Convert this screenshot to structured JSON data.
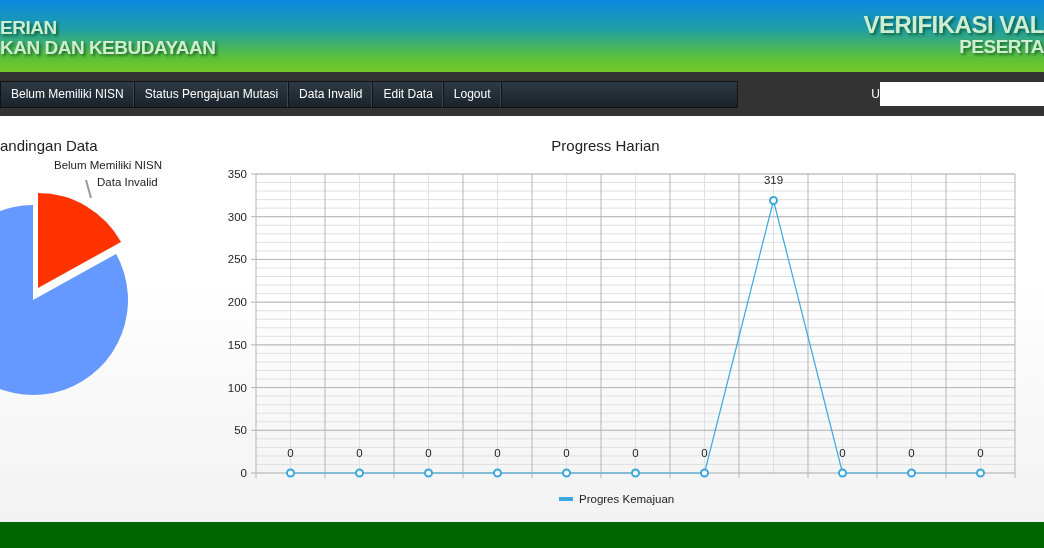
{
  "header": {
    "left_lines": [
      "ERIAN",
      "KAN DAN KEBUDAYAAN"
    ],
    "right_lines": [
      "VERIFIKASI VAL",
      "PESERTA"
    ]
  },
  "nav": {
    "items": [
      {
        "label": "Belum Memiliki NISN"
      },
      {
        "label": "Status Pengajuan Mutasi"
      },
      {
        "label": "Data Invalid"
      },
      {
        "label": "Edit Data"
      },
      {
        "label": "Logout"
      }
    ],
    "field_label": "U"
  },
  "pie_panel": {
    "title": "andingan Data",
    "labels": [
      "Belum Memiliki NISN",
      "Data Invalid"
    ]
  },
  "line_panel": {
    "chart_data": {
      "type": "line",
      "title": "Progress Harian",
      "ylim": [
        0,
        350
      ],
      "yticks": [
        0,
        50,
        100,
        150,
        200,
        250,
        300,
        350
      ],
      "data_labels": true,
      "grid": true,
      "series": [
        {
          "name": "Progres Kemajuan",
          "color": "#3aa7dd",
          "marker": true,
          "values": [
            0,
            0,
            0,
            0,
            0,
            0,
            0,
            319,
            0,
            0,
            0
          ]
        }
      ]
    }
  }
}
